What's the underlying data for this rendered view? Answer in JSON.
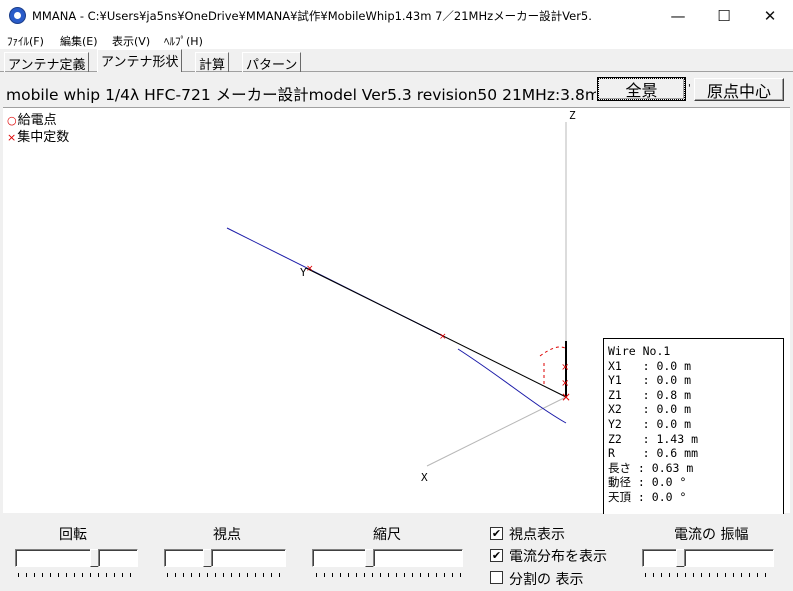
{
  "window": {
    "title": "MMANA - C:¥Users¥ja5ns¥OneDrive¥MMANA¥試作¥MobileWhip1.43m 7／21MHzメーカー設計Ver5.",
    "minimize": "—",
    "maximize": "☐",
    "close": "✕"
  },
  "menu": [
    "ﾌｧｲﾙ(F)",
    "編集(E)",
    "表示(V)",
    "ﾍﾙﾌﾟ(H)"
  ],
  "tabs": [
    "アンテナ定義",
    "アンテナ形状",
    "計算",
    "パターン"
  ],
  "active_tab": "アンテナ形状",
  "model_title": "mobile whip 1/4λ HFC-721 メーカー設計model Ver5.3 revision50 21MHz:3.8m",
  "buttons": {
    "full_view": "全景",
    "origin_center": "原点中心",
    "small_mark": "'"
  },
  "legend": {
    "feed_symbol": "○",
    "feed_label": "給電点",
    "load_symbol": "×",
    "load_label": "集中定数"
  },
  "axes": {
    "z": "Z",
    "x": "X",
    "y": "Y"
  },
  "wire_info": [
    "Wire No.1",
    "X1   : 0.0 m",
    "Y1   : 0.0 m",
    "Z1   : 0.8 m",
    "X2   : 0.0 m",
    "Y2   : 0.0 m",
    "Z2   : 1.43 m",
    "R    : 0.6 mm",
    "長さ : 0.63 m",
    "動径 : 0.0 °",
    "天頂 : 0.0 °"
  ],
  "controls": {
    "rotate": "回転",
    "viewpoint": "視点",
    "scale": "縮尺",
    "current_amplitude": "電流の 振幅"
  },
  "checkboxes": [
    {
      "label": "視点表示",
      "checked": true
    },
    {
      "label": "電流分布を表示",
      "checked": true
    },
    {
      "label": "分割の 表示",
      "checked": false
    }
  ],
  "colors": {
    "wire": "#000000",
    "current": "#1a1aa8",
    "marker": "#d00000",
    "axis": "#b0b0b0"
  }
}
